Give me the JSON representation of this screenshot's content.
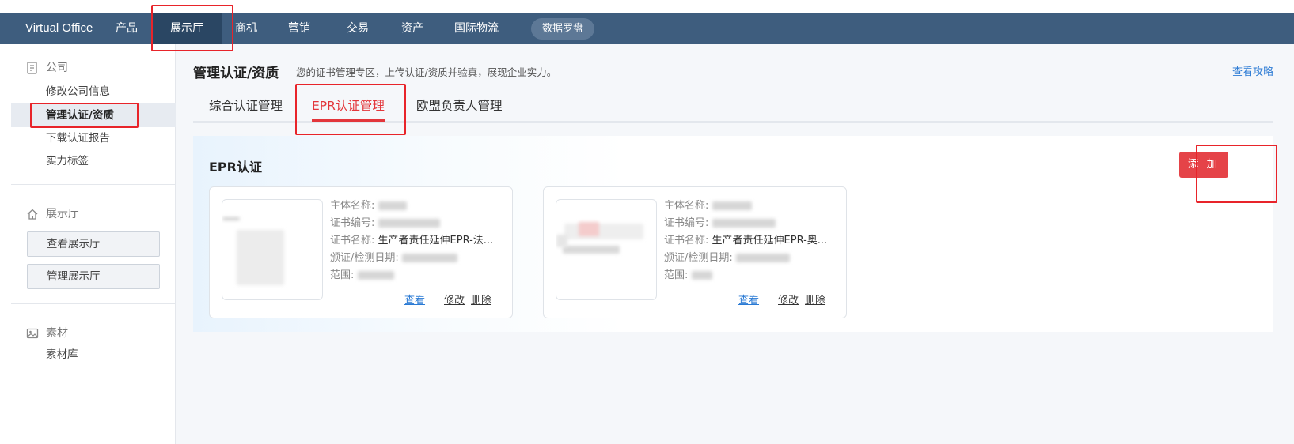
{
  "topnav": {
    "brand": "Virtual Office",
    "items": [
      "产品",
      "展示厅",
      "商机",
      "营销",
      "交易",
      "资产",
      "国际物流"
    ],
    "active_index": 1,
    "pill": "数据罗盘"
  },
  "sidebar": {
    "company": {
      "header": "公司",
      "links": [
        "修改公司信息",
        "管理认证/资质",
        "下载认证报告",
        "实力标签"
      ],
      "active_index": 1
    },
    "showroom": {
      "header": "展示厅",
      "buttons": [
        "查看展示厅",
        "管理展示厅"
      ]
    },
    "material": {
      "header": "素材",
      "links": [
        "素材库"
      ]
    }
  },
  "main": {
    "title": "管理认证/资质",
    "subtitle": "您的证书管理专区，上传认证/资质并验真，展现企业实力。",
    "guide_link": "查看攻略",
    "tabs": [
      "综合认证管理",
      "EPR认证管理",
      "欧盟负责人管理"
    ],
    "active_tab": 1,
    "panel": {
      "title": "EPR认证",
      "add_button": "添 加",
      "labels": {
        "subject": "主体名称:",
        "cert_no": "证书编号:",
        "cert_name": "证书名称:",
        "date": "颁证/检测日期:",
        "scope": "范围:"
      },
      "actions": {
        "view": "查看",
        "edit": "修改",
        "delete": "删除"
      },
      "cards": [
        {
          "subject": "",
          "cert_no": "",
          "cert_name": "生产者责任延伸EPR-法...",
          "date": "",
          "scope": ""
        },
        {
          "subject": "",
          "cert_no": "",
          "cert_name": "生产者责任延伸EPR-奥...",
          "date": "",
          "scope": ""
        }
      ]
    }
  },
  "colors": {
    "nav_bg": "#3e5d7e",
    "accent_red": "#e3363b",
    "link_blue": "#2a7ad4"
  }
}
